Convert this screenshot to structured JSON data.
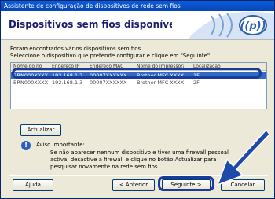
{
  "window": {
    "title": "Assistente de configuração de dispositivos de rede sem fios"
  },
  "header": {
    "title": "Dispositivos sem fios disponíveis"
  },
  "intro": {
    "line1": "Foram encontrados vários dispositivos sem fios.",
    "line2": "Seleccione o dispositivo que pretende configurar e clique em \"Seguinte\"."
  },
  "device_list": {
    "columns": [
      "Nome do nó",
      "Endereço IP",
      "Endereço MAC",
      "Nome do impressora",
      "Localização"
    ],
    "rows": [
      [
        "BRN000XXXX",
        "192.168.1.2",
        "00007XXXXXX",
        "Brother MFC-XXXX",
        "1F"
      ],
      [
        "BRN000XXXX",
        "192.168.1.3",
        "00007XXXXXX",
        "Brother MFC-XXXX",
        "2F"
      ]
    ],
    "selected_index": 0
  },
  "buttons": {
    "refresh": "Actualizar",
    "help": "Ajuda",
    "back": "< Anterior",
    "next": "Seguinte >",
    "cancel": "Cancelar"
  },
  "warning": {
    "title": "Aviso importante:",
    "text": "Se não aparecer nenhum dispositivo e tiver uma firewall pessoal activa, desactive a firewall e clique no botão Actualizar para pesquisar novamente na rede sem fios."
  },
  "colors": {
    "title_bar": "#0a5ddc",
    "selection": "#316ac5",
    "highlight_ring": "#1a3a9c"
  }
}
